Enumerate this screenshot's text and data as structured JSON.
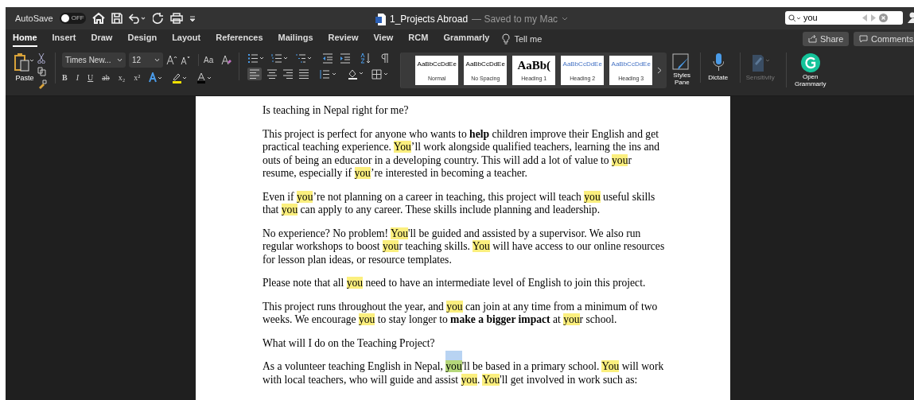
{
  "title_bar": {
    "autosave_label": "AutoSave",
    "autosave_on": false,
    "autosave_state": "OFF",
    "document_title": "1_Projects Abroad",
    "save_status": "— Saved to my Mac",
    "search": {
      "value": "you"
    }
  },
  "tabs": [
    {
      "label": "Home",
      "selected": true
    },
    {
      "label": "Insert",
      "selected": false
    },
    {
      "label": "Draw",
      "selected": false
    },
    {
      "label": "Design",
      "selected": false
    },
    {
      "label": "Layout",
      "selected": false
    },
    {
      "label": "References",
      "selected": false
    },
    {
      "label": "Mailings",
      "selected": false
    },
    {
      "label": "Review",
      "selected": false
    },
    {
      "label": "View",
      "selected": false
    },
    {
      "label": "RCM",
      "selected": false
    },
    {
      "label": "Grammarly",
      "selected": false
    }
  ],
  "tell_me": "Tell me",
  "share": "Share",
  "comments": "Comments",
  "ribbon": {
    "paste": "Paste",
    "font_name": "Times New...",
    "font_size": "12",
    "change_case": "Aa",
    "format_buttons": [
      "B",
      "I",
      "U",
      "ab",
      "x₂",
      "x²"
    ],
    "styles": [
      {
        "preview": "AaBbCcDdEe",
        "name": "Normal",
        "kind": "normal"
      },
      {
        "preview": "AaBbCcDdEe",
        "name": "No Spacing",
        "kind": "normal"
      },
      {
        "preview": "AaBb(",
        "name": "Heading 1",
        "kind": "heading1"
      },
      {
        "preview": "AaBbCcDdEe",
        "name": "Heading 2",
        "kind": "heading"
      },
      {
        "preview": "AaBbCcDdEe",
        "name": "Heading 3",
        "kind": "heading"
      }
    ],
    "styles_pane": "Styles Pane",
    "dictate": "Dictate",
    "sensitivity": {
      "label": "Sensitivity",
      "disabled": true
    },
    "open_grammarly": "Open Grammarly"
  },
  "document": {
    "paragraphs": [
      [
        {
          "text": "Is teaching in Nepal right for me?"
        }
      ],
      [
        {
          "text": "This project is perfect for anyone who wants to "
        },
        {
          "text": "help",
          "bold": true
        },
        {
          "text": " children improve their English and get practical teaching experience. "
        },
        {
          "text": "You",
          "highlighted": true
        },
        {
          "text": "’ll work alongside qualified teachers, learning the ins and outs of being an educator in a developing country. This will add a lot of value to "
        },
        {
          "text": "you",
          "highlighted": true
        },
        {
          "text": "r resume, especially if "
        },
        {
          "text": "you",
          "highlighted": true
        },
        {
          "text": "’re interested in becoming a teacher."
        }
      ],
      [
        {
          "text": "Even if "
        },
        {
          "text": "you",
          "highlighted": true
        },
        {
          "text": "’re not planning on a career in teaching, this project will teach "
        },
        {
          "text": "you",
          "highlighted": true
        },
        {
          "text": " useful skills that "
        },
        {
          "text": "you",
          "highlighted": true
        },
        {
          "text": " can apply to any career. These skills include planning and leadership."
        }
      ],
      [
        {
          "text": "No experience? No problem! "
        },
        {
          "text": "You",
          "highlighted": true
        },
        {
          "text": "'ll be guided and assisted by a supervisor. We also run regular workshops to boost "
        },
        {
          "text": "you",
          "highlighted": true
        },
        {
          "text": "r teaching skills. "
        },
        {
          "text": "You",
          "highlighted": true
        },
        {
          "text": " will have access to our online resources for lesson plan ideas, or resource templates."
        }
      ],
      [
        {
          "text": "Please note that all "
        },
        {
          "text": "you",
          "highlighted": true
        },
        {
          "text": " need to have an intermediate level of English to join this project."
        }
      ],
      [
        {
          "text": "This project runs throughout the year, and "
        },
        {
          "text": "you",
          "highlighted": true
        },
        {
          "text": " can join at any time from a minimum of two weeks. We encourage "
        },
        {
          "text": "you",
          "highlighted": true
        },
        {
          "text": " to stay longer to "
        },
        {
          "text": "make a bigger impact",
          "bold": true
        },
        {
          "text": " at "
        },
        {
          "text": "you",
          "highlighted": true
        },
        {
          "text": "r school."
        }
      ],
      [
        {
          "text": "What will I do on the Teaching Project?"
        }
      ],
      [
        {
          "text": "As a volunteer teaching English in Nepal, "
        },
        {
          "text": "you",
          "highlighted": true,
          "current": true
        },
        {
          "text": "'ll be based in a primary school. "
        },
        {
          "text": "You",
          "highlighted": true
        },
        {
          "text": " will work with local teachers, who will guide and assist "
        },
        {
          "text": "you",
          "highlighted": true
        },
        {
          "text": ". "
        },
        {
          "text": "You",
          "highlighted": true
        },
        {
          "text": "'ll get involved in work such as:"
        }
      ]
    ]
  }
}
